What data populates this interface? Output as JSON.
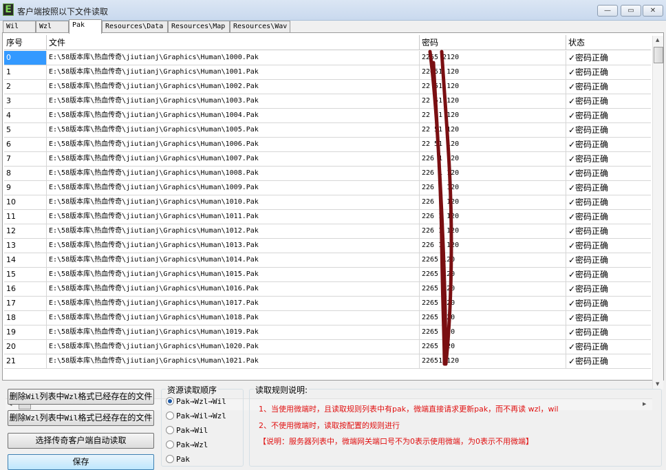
{
  "window": {
    "title": "客户端按照以下文件读取",
    "app_icon": "E",
    "controls": {
      "minimize": "—",
      "restore": "▭",
      "close": "✕"
    }
  },
  "tabs": [
    "Wil",
    "Wzl",
    "Pak",
    "Resources\\Data",
    "Resources\\Map",
    "Resources\\Wav"
  ],
  "active_tab": "Pak",
  "table": {
    "columns": [
      "序号",
      "文件",
      "密码",
      "状态"
    ],
    "rows": [
      {
        "idx": "0",
        "file": "E:\\58版本库\\热血传奇\\jiutianj\\Graphics\\Human\\1000.Pak",
        "pwd": "2265 2120",
        "status": "✓密码正确"
      },
      {
        "idx": "1",
        "file": "E:\\58版本库\\热血传奇\\jiutianj\\Graphics\\Human\\1001.Pak",
        "pwd": "22651 120",
        "status": "✓密码正确"
      },
      {
        "idx": "2",
        "file": "E:\\58版本库\\热血传奇\\jiutianj\\Graphics\\Human\\1002.Pak",
        "pwd": "22 51 120",
        "status": "✓密码正确"
      },
      {
        "idx": "3",
        "file": "E:\\58版本库\\热血传奇\\jiutianj\\Graphics\\Human\\1003.Pak",
        "pwd": "22 51 120",
        "status": "✓密码正确"
      },
      {
        "idx": "4",
        "file": "E:\\58版本库\\热血传奇\\jiutianj\\Graphics\\Human\\1004.Pak",
        "pwd": "22 51 120",
        "status": "✓密码正确"
      },
      {
        "idx": "5",
        "file": "E:\\58版本库\\热血传奇\\jiutianj\\Graphics\\Human\\1005.Pak",
        "pwd": "22 51 120",
        "status": "✓密码正确"
      },
      {
        "idx": "6",
        "file": "E:\\58版本库\\热血传奇\\jiutianj\\Graphics\\Human\\1006.Pak",
        "pwd": "22 51 120",
        "status": "✓密码正确"
      },
      {
        "idx": "7",
        "file": "E:\\58版本库\\热血传奇\\jiutianj\\Graphics\\Human\\1007.Pak",
        "pwd": "226 1 120",
        "status": "✓密码正确"
      },
      {
        "idx": "8",
        "file": "E:\\58版本库\\热血传奇\\jiutianj\\Graphics\\Human\\1008.Pak",
        "pwd": "226 1 120",
        "status": "✓密码正确"
      },
      {
        "idx": "9",
        "file": "E:\\58版本库\\热血传奇\\jiutianj\\Graphics\\Human\\1009.Pak",
        "pwd": "226 1 120",
        "status": "✓密码正确"
      },
      {
        "idx": "10",
        "file": "E:\\58版本库\\热血传奇\\jiutianj\\Graphics\\Human\\1010.Pak",
        "pwd": "226 1 120",
        "status": "✓密码正确"
      },
      {
        "idx": "11",
        "file": "E:\\58版本库\\热血传奇\\jiutianj\\Graphics\\Human\\1011.Pak",
        "pwd": "226 1 120",
        "status": "✓密码正确"
      },
      {
        "idx": "12",
        "file": "E:\\58版本库\\热血传奇\\jiutianj\\Graphics\\Human\\1012.Pak",
        "pwd": "226 1 120",
        "status": "✓密码正确"
      },
      {
        "idx": "13",
        "file": "E:\\58版本库\\热血传奇\\jiutianj\\Graphics\\Human\\1013.Pak",
        "pwd": "226 1 120",
        "status": "✓密码正确"
      },
      {
        "idx": "14",
        "file": "E:\\58版本库\\热血传奇\\jiutianj\\Graphics\\Human\\1014.Pak",
        "pwd": "2265 120",
        "status": "✓密码正确"
      },
      {
        "idx": "15",
        "file": "E:\\58版本库\\热血传奇\\jiutianj\\Graphics\\Human\\1015.Pak",
        "pwd": "2265 120",
        "status": "✓密码正确"
      },
      {
        "idx": "16",
        "file": "E:\\58版本库\\热血传奇\\jiutianj\\Graphics\\Human\\1016.Pak",
        "pwd": "2265 120",
        "status": "✓密码正确"
      },
      {
        "idx": "17",
        "file": "E:\\58版本库\\热血传奇\\jiutianj\\Graphics\\Human\\1017.Pak",
        "pwd": "2265 120",
        "status": "✓密码正确"
      },
      {
        "idx": "18",
        "file": "E:\\58版本库\\热血传奇\\jiutianj\\Graphics\\Human\\1018.Pak",
        "pwd": "2265 120",
        "status": "✓密码正确"
      },
      {
        "idx": "19",
        "file": "E:\\58版本库\\热血传奇\\jiutianj\\Graphics\\Human\\1019.Pak",
        "pwd": "2265 120",
        "status": "✓密码正确"
      },
      {
        "idx": "20",
        "file": "E:\\58版本库\\热血传奇\\jiutianj\\Graphics\\Human\\1020.Pak",
        "pwd": "2265 120",
        "status": "✓密码正确"
      },
      {
        "idx": "21",
        "file": "E:\\58版本库\\热血传奇\\jiutianj\\Graphics\\Human\\1021.Pak",
        "pwd": "22651 120",
        "status": "✓密码正确"
      }
    ],
    "selected_row": 0
  },
  "buttons": {
    "delete_wil_prefix": "删除",
    "delete_wil_mono": "Wil",
    "delete_wil_mid": "列表中",
    "delete_wil_mono2": "Wzl",
    "delete_wil_suffix": "格式已经存在的文件",
    "delete_wzl_prefix": "删除",
    "delete_wzl_mono": "Wzl",
    "delete_wzl_mid": "列表中",
    "delete_wzl_mono2": "Wil",
    "delete_wzl_suffix": "格式已经存在的文件",
    "auto_read": "选择传奇客户端自动读取",
    "save": "保存"
  },
  "read_order": {
    "title": "资源读取顺序",
    "options": [
      "Pak→Wzl→Wil",
      "Pak→Wil→Wzl",
      "Pak→Wil",
      "Pak→Wzl",
      "Pak"
    ],
    "selected": 0
  },
  "rules": {
    "title": "读取规则说明:",
    "lines": [
      "1、当使用微端时，且读取规则列表中有pak，微端直接请求更新pak，而不再读 wzl，wil",
      "2、不使用微端时，读取按配置的规则进行",
      "【说明：服务器列表中，微端网关端口号不为0表示使用微端，为0表示不用微端】"
    ]
  },
  "colors": {
    "selection": "#3399ff",
    "rule_text": "#e01010",
    "scribble": "#7a0f12"
  }
}
